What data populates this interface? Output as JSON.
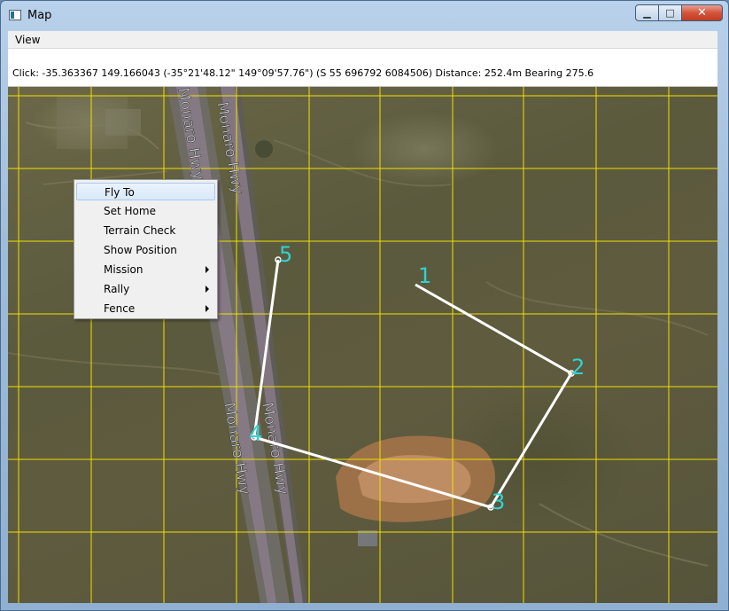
{
  "window": {
    "title": "Map"
  },
  "titlebar": {
    "minimize_glyph": "▁",
    "maximize_glyph": "□",
    "close_glyph": "✕"
  },
  "menu": {
    "view_label": "View"
  },
  "status": {
    "text": "Click: -35.363367 149.166043 (-35°21'48.12\" 149°09'57.76\") (S 55 696792 6084506)  Distance: 252.4m Bearing 275.6"
  },
  "map": {
    "road_labels": [
      "Monaro Hwy",
      "Monaro Hwy",
      "Monaro Hwy",
      "Monaro Hwy"
    ],
    "waypoints": [
      {
        "label": "1"
      },
      {
        "label": "2"
      },
      {
        "label": "3"
      },
      {
        "label": "4"
      },
      {
        "label": "5"
      }
    ],
    "colors": {
      "grid": "#f0e000",
      "route": "#ffffff",
      "waypoint_label": "#2fd3d3",
      "road": "#8a7d8a"
    }
  },
  "context_menu": {
    "items": [
      {
        "label": "Fly To",
        "submenu": false,
        "highlighted": true
      },
      {
        "label": "Set Home",
        "submenu": false
      },
      {
        "label": "Terrain Check",
        "submenu": false
      },
      {
        "label": "Show Position",
        "submenu": false
      },
      {
        "label": "Mission",
        "submenu": true
      },
      {
        "label": "Rally",
        "submenu": true
      },
      {
        "label": "Fence",
        "submenu": true
      }
    ]
  }
}
